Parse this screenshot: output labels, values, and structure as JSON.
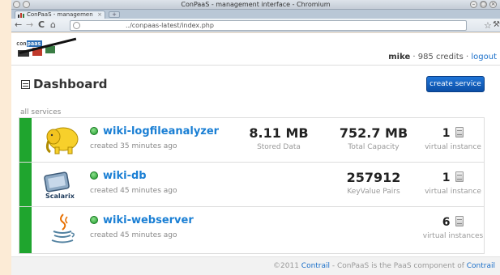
{
  "window": {
    "title": "ConPaaS - management interface - Chromium"
  },
  "tab": {
    "label": "ConPaaS - managemen",
    "close": "×"
  },
  "toolbar": {
    "back": "←",
    "forward": "→",
    "reload": "C",
    "home": "⌂",
    "url": "../conpaas-latest/index.php",
    "star": "☆",
    "wrench": "🔧"
  },
  "header": {
    "logo_text_prefix": "con",
    "logo_text_highlight": "paas",
    "username": "mike",
    "credits": " · 985 credits · ",
    "logout": "logout"
  },
  "dashboard": {
    "title": "Dashboard",
    "create_button": "create service",
    "section_label": "all services"
  },
  "services": [
    {
      "name": "wiki-logfileanalyzer",
      "created": "created 35 minutes ago",
      "icon": "hadoop-elephant-icon",
      "metrics": [
        {
          "value": "8.11 MB",
          "label": "Stored Data"
        },
        {
          "value": "752.7 MB",
          "label": "Total Capacity"
        }
      ],
      "instances": "1",
      "instances_label": "virtual instance",
      "status_color": "#1fa52e"
    },
    {
      "name": "wiki-db",
      "created": "created 45 minutes ago",
      "icon": "scalarix-icon",
      "metrics": [
        {
          "value": "257912",
          "label": "KeyValue Pairs"
        }
      ],
      "instances": "1",
      "instances_label": "virtual instance",
      "status_color": "#1fa52e"
    },
    {
      "name": "wiki-webserver",
      "created": "created 45 minutes ago",
      "icon": "java-cup-icon",
      "metrics": [],
      "instances": "6",
      "instances_label": "virtual instances",
      "status_color": "#1fa52e"
    }
  ],
  "footer": {
    "copyright": "©2011 ",
    "link1": "Contrail",
    "middle": " - ConPaaS is the PaaS component of ",
    "link2": "Contrail"
  },
  "colors": {
    "accent": "#1a7fd4",
    "button": "#0b4fa6",
    "status_green": "#1fa52e",
    "background": "#fcebd6"
  }
}
